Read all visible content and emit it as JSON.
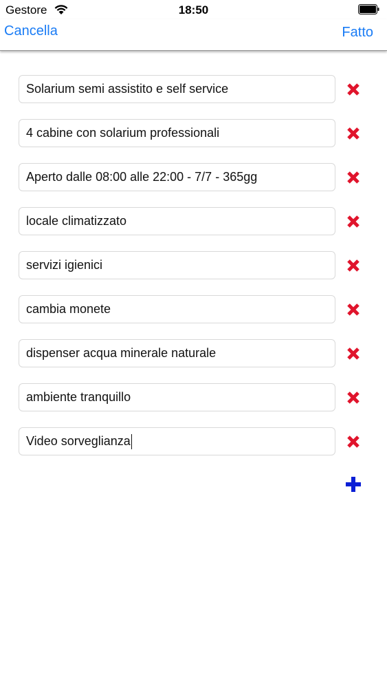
{
  "status_bar": {
    "carrier": "Gestore",
    "time": "18:50"
  },
  "nav": {
    "cancel_label": "Cancella",
    "done_label": "Fatto"
  },
  "items": [
    {
      "value": "Solarium semi assistito e self service"
    },
    {
      "value": "4 cabine con solarium professionali"
    },
    {
      "value": "Aperto dalle 08:00 alle 22:00 - 7/7 - 365gg"
    },
    {
      "value": "locale climatizzato"
    },
    {
      "value": "servizi igienici"
    },
    {
      "value": "cambia monete"
    },
    {
      "value": "dispenser acqua minerale naturale"
    },
    {
      "value": "ambiente tranquillo"
    },
    {
      "value": "Video sorveglianza"
    }
  ],
  "icons": {
    "delete": "delete-x-icon",
    "add": "plus-icon",
    "wifi": "wifi-icon",
    "battery": "battery-icon"
  },
  "colors": {
    "accent": "#1a7cf5",
    "delete": "#e0142c",
    "add": "#0a1fd6"
  }
}
